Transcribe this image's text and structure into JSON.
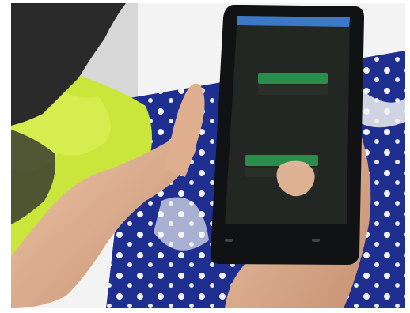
{
  "photo": {
    "subject": "hands-holding-smartphone-showing-quiz-app",
    "colors": {
      "bed_sheet": "#f3f3f3",
      "towel": "#cbe63a",
      "blanket": "#1f2f8f",
      "skin": "#e2b18f",
      "phone_body": "#111214",
      "screen_bg": "#232723",
      "screen_topbar": "#3c78c6",
      "answer_green": "#2a8d4b"
    }
  },
  "phone_screen": {
    "header_title": "",
    "q1_text": "",
    "q1_option_selected": "",
    "q1_option_other": "",
    "q2_text": "",
    "q2_option_selected": "",
    "q2_option_other": "",
    "q3_text": ""
  }
}
